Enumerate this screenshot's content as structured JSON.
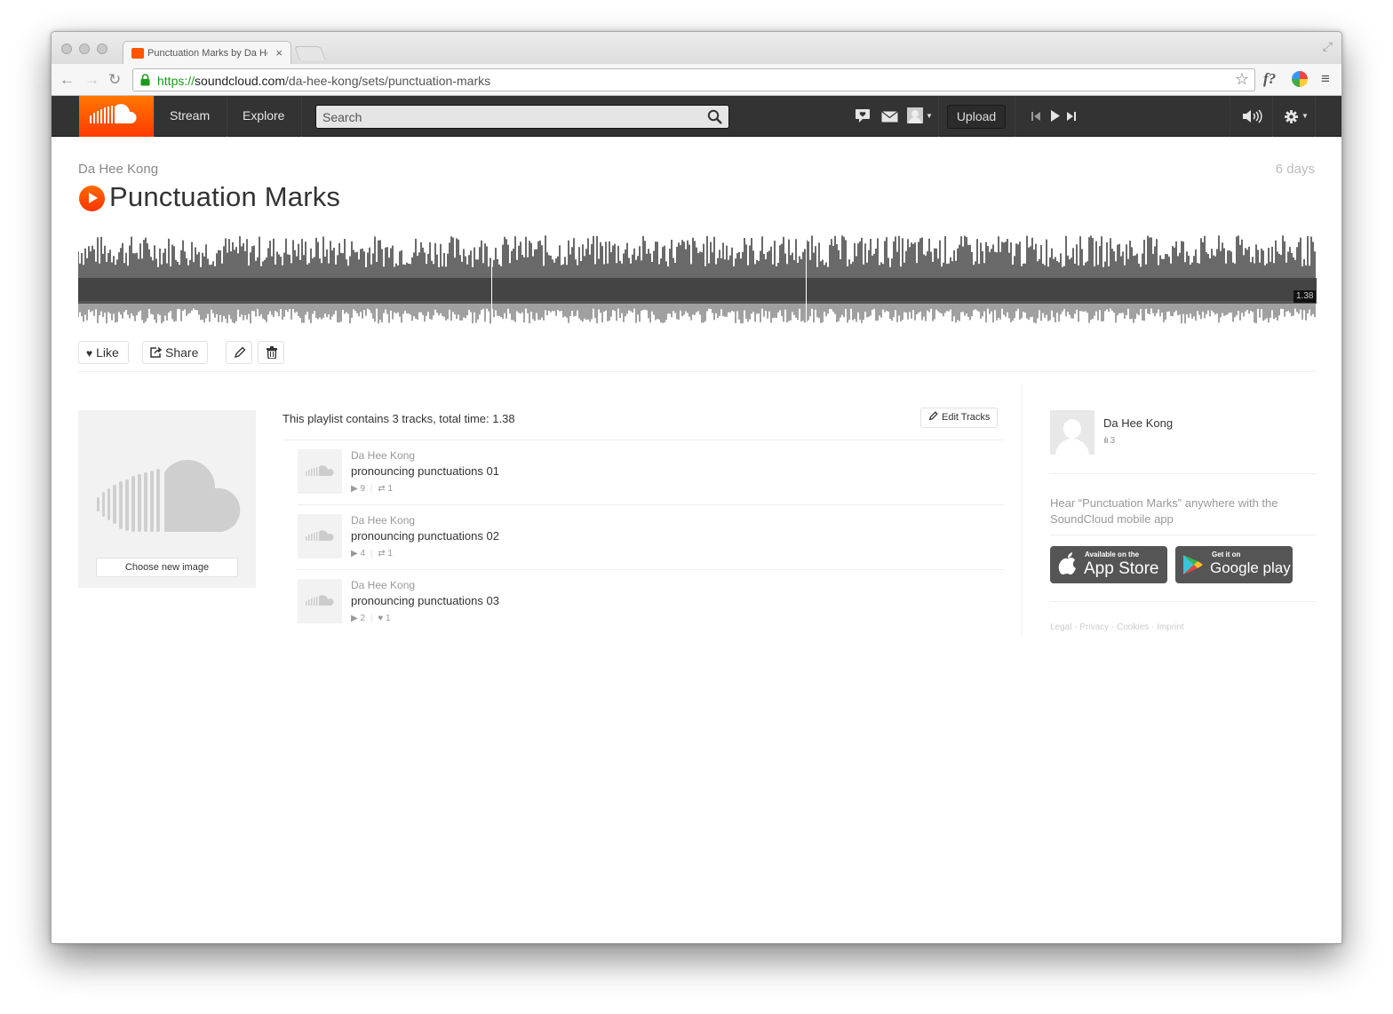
{
  "browser": {
    "tab_title": "Punctuation Marks by Da Hee Kong",
    "tab_close": "×",
    "url_protocol": "https://",
    "url_domain": "soundcloud.com",
    "url_path": "/da-hee-kong/sets/punctuation-marks"
  },
  "header": {
    "nav": {
      "stream": "Stream",
      "explore": "Explore"
    },
    "search_placeholder": "Search",
    "upload_label": "Upload",
    "brand_color": "#ff5500"
  },
  "playlist": {
    "artist": "Da Hee Kong",
    "age": "6 days",
    "title": "Punctuation Marks",
    "duration_badge": "1.38",
    "actions": {
      "like": "Like",
      "share": "Share"
    },
    "choose_image": "Choose new image",
    "summary": "This playlist contains 3 tracks, total time: 1.38",
    "edit_tracks": "Edit Tracks",
    "tracks": [
      {
        "artist": "Da Hee Kong",
        "name": "pronouncing punctuations 01",
        "plays": "9",
        "second_icon": "repost-icon",
        "second_count": "1"
      },
      {
        "artist": "Da Hee Kong",
        "name": "pronouncing punctuations 02",
        "plays": "4",
        "second_icon": "repost-icon",
        "second_count": "1"
      },
      {
        "artist": "Da Hee Kong",
        "name": "pronouncing punctuations 03",
        "plays": "2",
        "second_icon": "heart-icon",
        "second_count": "1"
      }
    ]
  },
  "sidebar": {
    "user_name": "Da Hee Kong",
    "tracks_count": "3",
    "hear_text": "Hear “Punctuation Marks” anywhere with the SoundCloud mobile app",
    "app_store": {
      "small": "Available on the",
      "big": "App Store"
    },
    "google_play": {
      "small": "Get it on",
      "big": "Google play"
    },
    "footer": "Legal · Privacy · Cookies · Imprint"
  }
}
